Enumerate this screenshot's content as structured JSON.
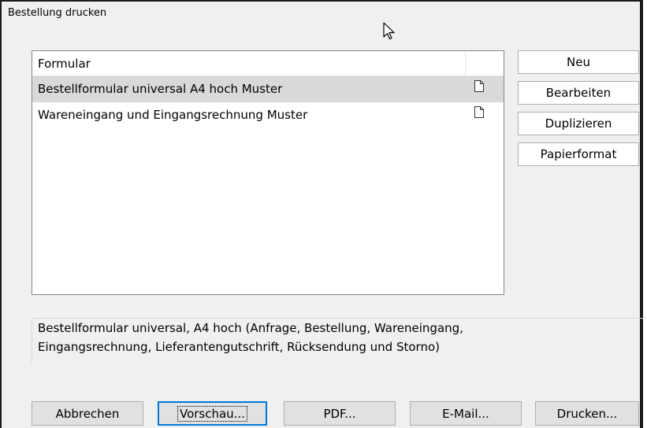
{
  "window": {
    "title": "Bestellung drucken"
  },
  "list": {
    "column_header": "Formular",
    "rows": [
      {
        "label": "Bestellformular universal A4 hoch Muster",
        "icon": "document-icon",
        "selected": true
      },
      {
        "label": "Wareneingang und Eingangsrechnung Muster",
        "icon": "document-icon",
        "selected": false
      }
    ]
  },
  "side_buttons": {
    "neu": "Neu",
    "bearbeiten": "Bearbeiten",
    "duplizieren": "Duplizieren",
    "papierformat": "Papierformat"
  },
  "description": {
    "line1": "Bestellformular universal, A4 hoch (Anfrage, Bestellung, Wareneingang,",
    "line2": "Eingangsrechnung, Lieferantengutschrift, Rücksendung und Storno)"
  },
  "bottom_buttons": {
    "abbrechen": "Abbrechen",
    "vorschau": "Vorschau...",
    "pdf": "PDF...",
    "email": "E-Mail...",
    "drucken": "Drucken..."
  },
  "colors": {
    "focus_border": "#0078d7",
    "selected_row": "#d9d9d9",
    "window_bg": "#f0f0f0"
  }
}
